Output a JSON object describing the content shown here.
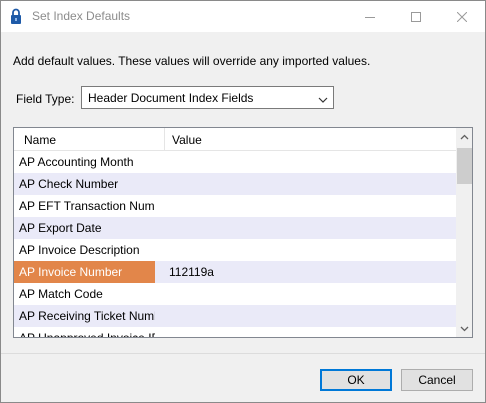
{
  "window": {
    "title": "Set Index Defaults"
  },
  "intro_text": "Add default values. These values will override any imported values.",
  "field_type": {
    "label": "Field Type:",
    "selected": "Header Document Index Fields"
  },
  "grid": {
    "columns": [
      "Name",
      "Value"
    ],
    "rows": [
      {
        "name": "AP Accounting Month",
        "value": ""
      },
      {
        "name": "AP Check Number",
        "value": ""
      },
      {
        "name": "AP EFT Transaction Number",
        "value": ""
      },
      {
        "name": "AP Export Date",
        "value": ""
      },
      {
        "name": "AP Invoice Description",
        "value": ""
      },
      {
        "name": "AP Invoice Number",
        "value": "112119a"
      },
      {
        "name": "AP Match Code",
        "value": ""
      },
      {
        "name": "AP Receiving Ticket Number",
        "value": ""
      },
      {
        "name": "AP Unapproved Invoice ID",
        "value": ""
      }
    ],
    "selected_row": 5,
    "colors": {
      "selected": "#e2864a",
      "alt_row": "#eaeaf8"
    }
  },
  "buttons": {
    "ok": "OK",
    "cancel": "Cancel"
  },
  "icons": {
    "title": "lock-icon",
    "minimize": "minimize-icon",
    "maximize": "maximize-icon",
    "close": "close-icon"
  }
}
